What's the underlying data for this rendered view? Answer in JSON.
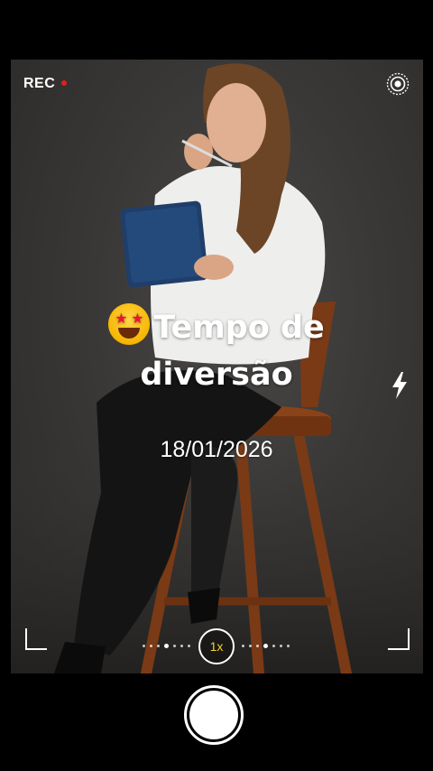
{
  "status": {
    "rec_label": "REC"
  },
  "icons": {
    "live": "live-photo-icon",
    "flash": "flash-icon",
    "emoji": "star-struck-emoji"
  },
  "overlay": {
    "title_line1": "Tempo de",
    "title_line2": "diversão",
    "date": "18/01/2026"
  },
  "zoom": {
    "label": "1x"
  },
  "colors": {
    "rec_dot": "#e0201b",
    "zoom_text": "#f3d12f",
    "background": "#000000"
  }
}
